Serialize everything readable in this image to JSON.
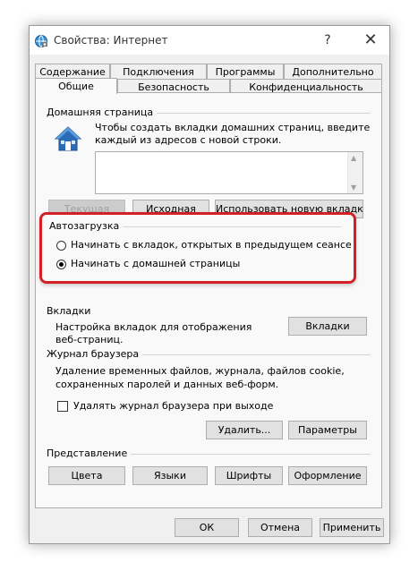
{
  "window": {
    "title": "Свойства: Интернет",
    "help_glyph": "?",
    "close_glyph": "✕"
  },
  "tabs_row_top": [
    "Содержание",
    "Подключения",
    "Программы",
    "Дополнительно"
  ],
  "tabs_row_bottom": [
    "Общие",
    "Безопасность",
    "Конфиденциальность"
  ],
  "homepage": {
    "group_label": "Домашняя страница",
    "description_line1": "Чтобы создать вкладки домашних страниц, введите",
    "description_line2": "каждый из адресов с новой строки.",
    "address_value": "",
    "btn_current": "Текущая",
    "btn_default": "Исходная",
    "btn_new_tab": "Использовать новую вкладку"
  },
  "startup": {
    "group_label": "Автозагрузка",
    "option1": "Начинать с вкладок, открытых в предыдущем сеансе",
    "option2": "Начинать с домашней страницы",
    "selected": "option2"
  },
  "tabs_section": {
    "group_label": "Вкладки",
    "description_line1": "Настройка вкладок для отображения",
    "description_line2": "веб-страниц.",
    "button": "Вкладки"
  },
  "history": {
    "group_label": "Журнал браузера",
    "description_line1": "Удаление временных файлов, журнала, файлов cookie,",
    "description_line2": "сохраненных паролей и данных веб-форм.",
    "checkbox_label": "Удалять журнал браузера при выходе",
    "checkbox_checked": false,
    "btn_delete": "Удалить...",
    "btn_settings": "Параметры"
  },
  "appearance": {
    "group_label": "Представление",
    "btn_colors": "Цвета",
    "btn_languages": "Языки",
    "btn_fonts": "Шрифты",
    "btn_accessibility": "Оформление"
  },
  "footer": {
    "ok": "ОК",
    "cancel": "Отмена",
    "apply": "Применить"
  },
  "colors": {
    "highlight_border": "#d32027",
    "dialog_bg": "#f0f0f0",
    "panel_bg": "#f9f9f9"
  }
}
